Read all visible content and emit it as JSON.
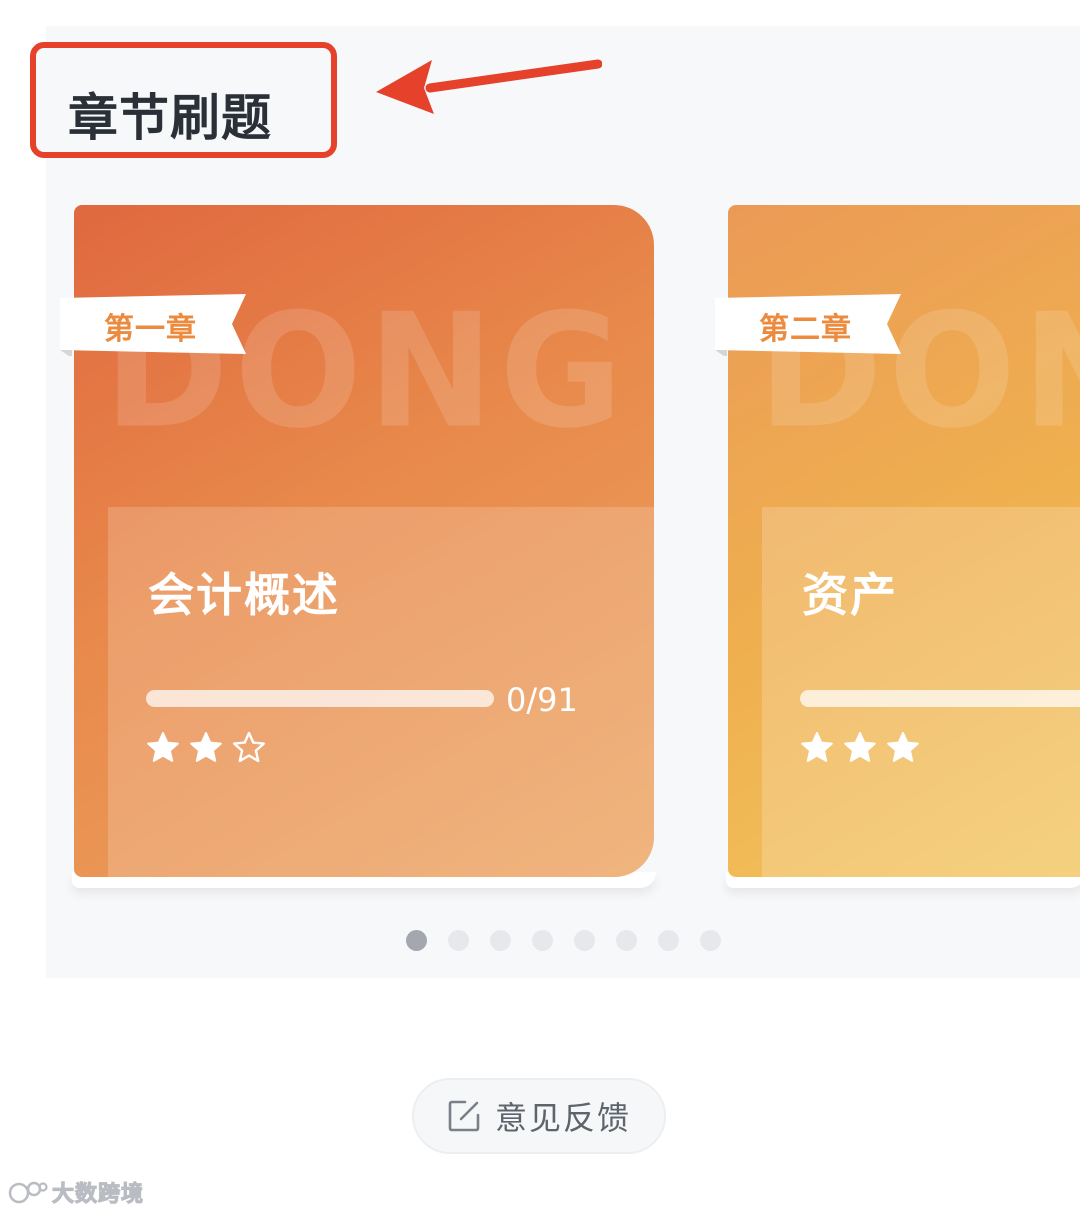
{
  "section": {
    "title": "章节刷题"
  },
  "chapters": [
    {
      "tag": "第一章",
      "name": "会计概述",
      "progress_text": "0/91",
      "progress_fraction": 0,
      "stars_filled": 2,
      "stars_total": 3,
      "watermark": "DONG AO"
    },
    {
      "tag": "第二章",
      "name": "资产",
      "progress_text": "",
      "progress_fraction": 0,
      "stars_filled": 3,
      "stars_total": 3,
      "watermark": "DONG"
    }
  ],
  "pager": {
    "count": 8,
    "active_index": 0
  },
  "feedback": {
    "label": "意见反馈",
    "icon": "edit-icon"
  },
  "footer": {
    "brand": "大数跨境",
    "icon": "brand-logo-icon"
  },
  "colors": {
    "highlight_red": "#e5412b",
    "card1_start": "#e0683f",
    "card1_end": "#eda563",
    "card2_start": "#eb9a56",
    "card2_end": "#f3c760",
    "ribbon_text": "#ec8a3e"
  }
}
